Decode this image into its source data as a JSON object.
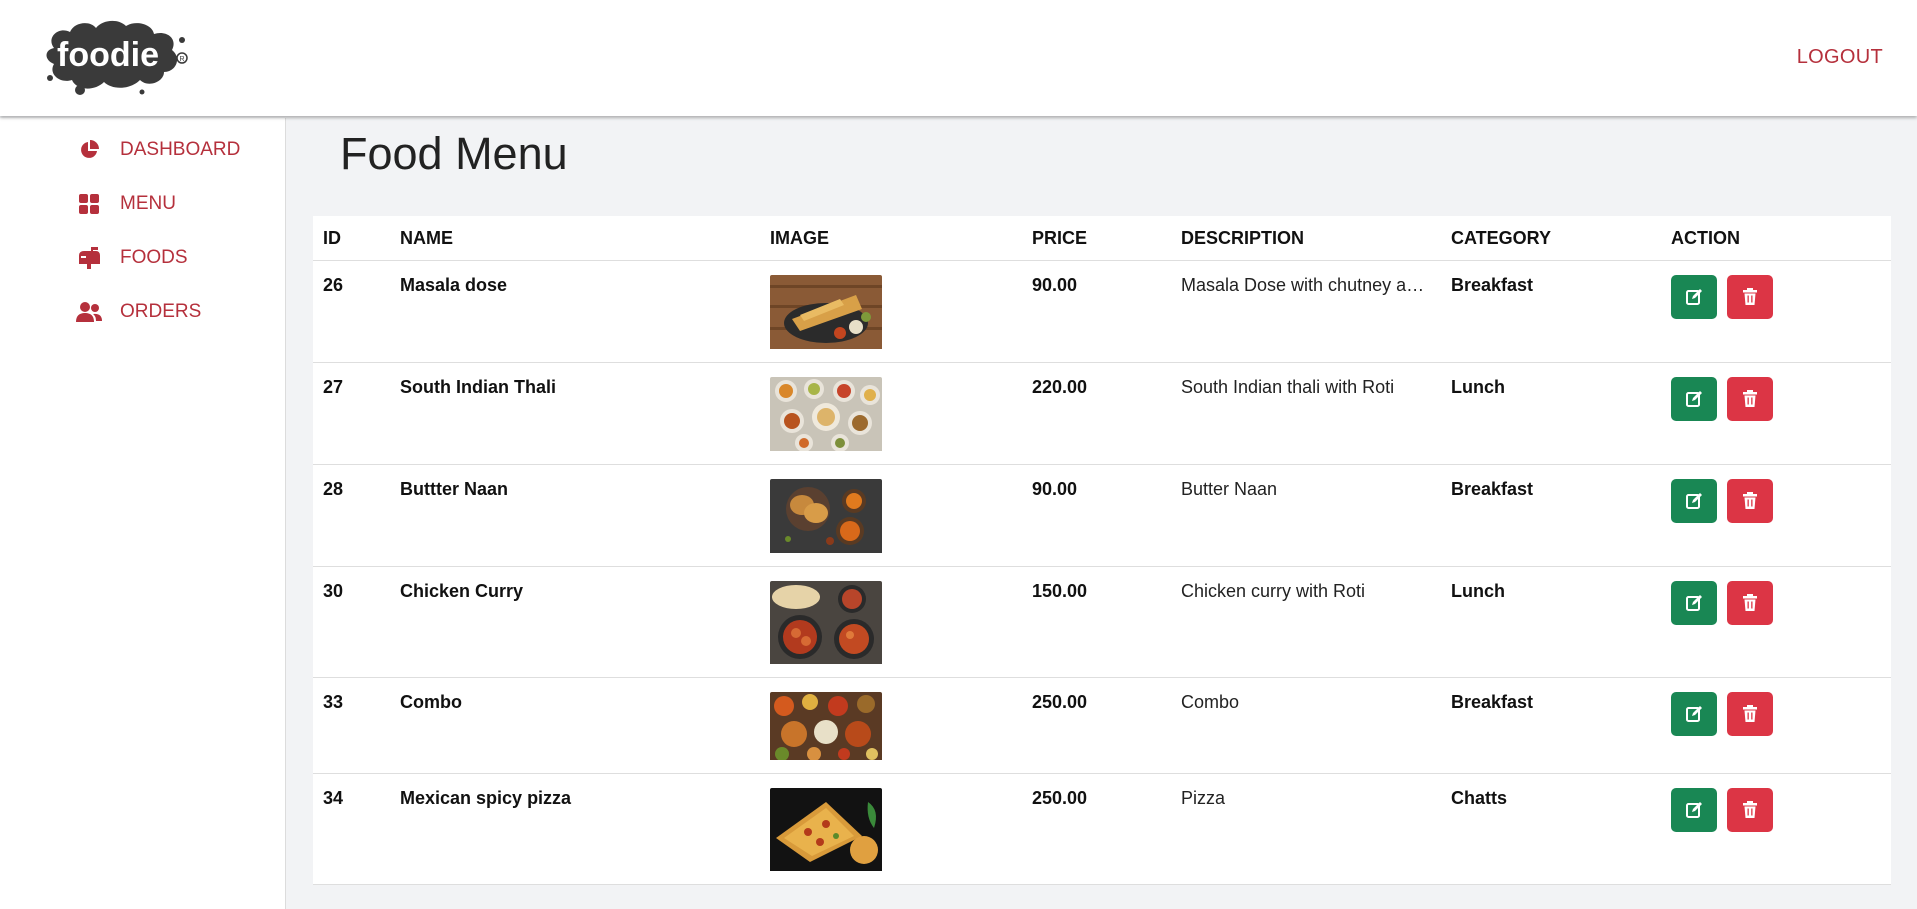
{
  "header": {
    "logo_text": "foodie",
    "logout_label": "LOGOUT"
  },
  "sidebar": {
    "items": [
      {
        "label": "DASHBOARD",
        "icon": "pie-chart-icon"
      },
      {
        "label": "MENU",
        "icon": "grid-icon"
      },
      {
        "label": "FOODS",
        "icon": "mailbox-icon"
      },
      {
        "label": "ORDERS",
        "icon": "users-icon"
      }
    ]
  },
  "page_title": "Food Menu",
  "table": {
    "columns": [
      "ID",
      "NAME",
      "IMAGE",
      "PRICE",
      "DESCRIPTION",
      "CATEGORY",
      "ACTION"
    ],
    "rows": [
      {
        "id": "26",
        "name": "Masala dose",
        "price": "90.00",
        "description": "Masala Dose with chutney an...",
        "category": "Breakfast",
        "image": "masala-dosa-photo"
      },
      {
        "id": "27",
        "name": "South Indian Thali",
        "price": "220.00",
        "description": "South Indian thali with Roti",
        "category": "Lunch",
        "image": "thali-photo"
      },
      {
        "id": "28",
        "name": "Buttter Naan",
        "price": "90.00",
        "description": "Butter Naan",
        "category": "Breakfast",
        "image": "naan-photo"
      },
      {
        "id": "30",
        "name": "Chicken Curry",
        "price": "150.00",
        "description": "Chicken curry with Roti",
        "category": "Lunch",
        "image": "chicken-curry-photo"
      },
      {
        "id": "33",
        "name": "Combo",
        "price": "250.00",
        "description": "Combo",
        "category": "Breakfast",
        "image": "combo-photo"
      },
      {
        "id": "34",
        "name": "Mexican spicy pizza",
        "price": "250.00",
        "description": "Pizza",
        "category": "Chatts",
        "image": "pizza-photo"
      }
    ]
  },
  "colors": {
    "accent": "#b5303c",
    "edit": "#198754",
    "delete": "#dc3545",
    "background": "#f2f3f5"
  }
}
